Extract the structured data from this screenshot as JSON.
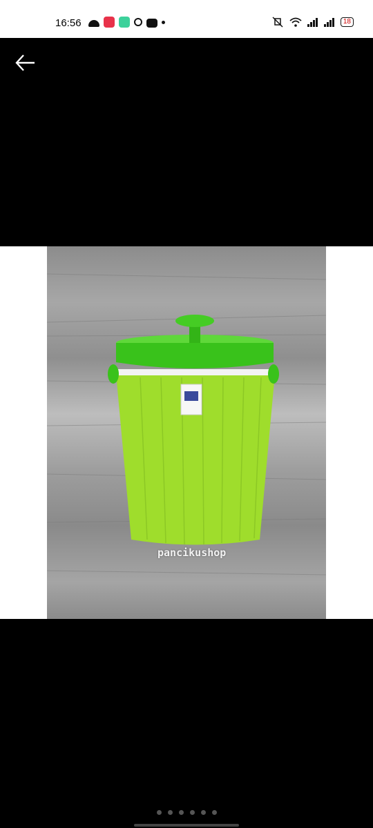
{
  "status_bar": {
    "time": "16:56",
    "battery": "18",
    "left_icons": [
      "cloud-icon",
      "screen-record-icon",
      "app-icon",
      "google-icon",
      "youtube-icon",
      "more-dot-icon"
    ],
    "right_icons": [
      "mute-vibrate-icon",
      "wifi-icon",
      "signal-icon",
      "signal-icon"
    ]
  },
  "viewer": {
    "back_icon": "arrow-left-icon",
    "watermark": "pancikushop",
    "image_description": "green plastic bucket with lid on grey wood background",
    "page_count": 6,
    "current_page": 1
  },
  "colors": {
    "background": "#000000",
    "bucket_body": "#9fdd2c",
    "bucket_lid": "#39c21b"
  }
}
